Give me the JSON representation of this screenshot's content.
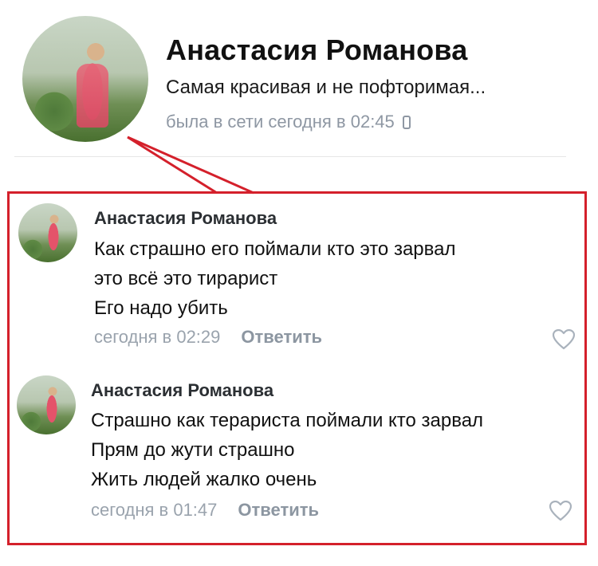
{
  "profile": {
    "name": "Анастасия Романова",
    "status": "Самая красивая и не пофторимая...",
    "online": "была в сети сегодня в 02:45",
    "online_icon": "mobile-phone-icon"
  },
  "comments": [
    {
      "author": "Анастасия Романова",
      "lines": [
        "Как страшно его поймали кто это зарвал",
        "это всё это тирарист",
        "Его надо убить"
      ],
      "time": "сегодня в 02:29",
      "reply_label": "Ответить",
      "like_icon": "heart-icon"
    },
    {
      "author": "Анастасия Романова",
      "lines": [
        "Страшно как терариста поймали кто зарвал",
        "Прям до жути страшно",
        "Жить людей жалко очень"
      ],
      "time": "сегодня в 01:47",
      "reply_label": "Ответить",
      "like_icon": "heart-icon"
    }
  ],
  "colors": {
    "highlight": "#d4202b",
    "meta_text": "#9aa3ad",
    "reply_text": "#8c96a1"
  }
}
